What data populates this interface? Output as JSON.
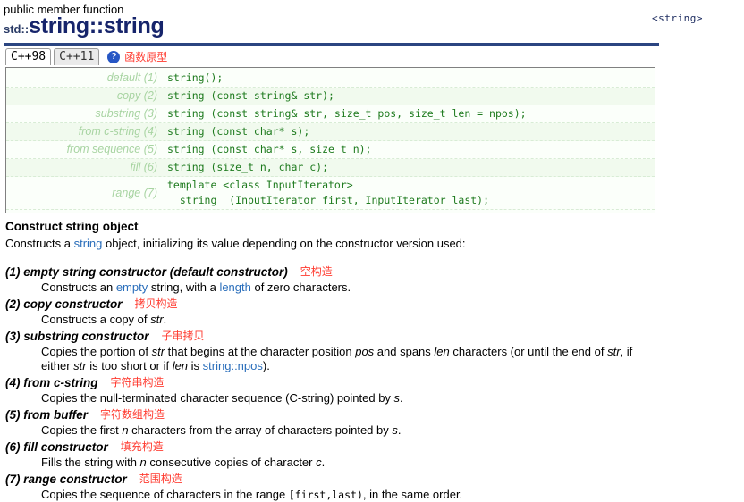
{
  "header": {
    "kind": "public member function",
    "namespace": "std::",
    "name": "string::string",
    "header_file": "<string>"
  },
  "tabs": {
    "items": [
      {
        "label": "C++98",
        "active": true
      },
      {
        "label": "C++11",
        "active": false
      }
    ],
    "help_icon": "question-mark-icon",
    "help_glyph": "?",
    "annotation": "函数原型"
  },
  "prototypes": [
    {
      "label": "default (1)",
      "code": "string();"
    },
    {
      "label": "copy (2)",
      "code": "string (const string& str);"
    },
    {
      "label": "substring (3)",
      "code": "string (const string& str, size_t pos, size_t len = npos);"
    },
    {
      "label": "from c-string (4)",
      "code": "string (const char* s);"
    },
    {
      "label": "from sequence (5)",
      "code": "string (const char* s, size_t n);"
    },
    {
      "label": "fill (6)",
      "code": "string (size_t n, char c);"
    },
    {
      "label": "range (7)",
      "code": "template <class InputIterator>\n  string  (InputIterator first, InputIterator last);"
    }
  ],
  "section": {
    "title": "Construct string object",
    "intro_before": "Constructs a ",
    "intro_link": "string",
    "intro_after": " object, initializing its value depending on the constructor version used:"
  },
  "constructors": [
    {
      "heading": "(1) empty string constructor (default constructor)",
      "annotation": "空构造",
      "desc_parts": [
        {
          "t": "Constructs an "
        },
        {
          "t": "empty",
          "k": "link"
        },
        {
          "t": " string, with a "
        },
        {
          "t": "length",
          "k": "link"
        },
        {
          "t": " of zero characters."
        }
      ]
    },
    {
      "heading": "(2) copy constructor",
      "annotation": "拷贝构造",
      "desc_parts": [
        {
          "t": "Constructs a copy of "
        },
        {
          "t": "str",
          "k": "it"
        },
        {
          "t": "."
        }
      ]
    },
    {
      "heading": "(3) substring constructor",
      "annotation": "子串拷贝",
      "desc_parts": [
        {
          "t": "Copies the portion of "
        },
        {
          "t": "str",
          "k": "it"
        },
        {
          "t": " that begins at the character position "
        },
        {
          "t": "pos",
          "k": "it"
        },
        {
          "t": " and spans "
        },
        {
          "t": "len",
          "k": "it"
        },
        {
          "t": " characters (or until the end of "
        },
        {
          "t": "str",
          "k": "it"
        },
        {
          "t": ", if either "
        },
        {
          "t": "str",
          "k": "it"
        },
        {
          "t": " is too short or if "
        },
        {
          "t": "len",
          "k": "it"
        },
        {
          "t": " is "
        },
        {
          "t": "string::npos",
          "k": "link"
        },
        {
          "t": ")."
        }
      ]
    },
    {
      "heading": "(4) from c-string",
      "annotation": "字符串构造",
      "desc_parts": [
        {
          "t": "Copies the null-terminated character sequence (C-string) pointed by "
        },
        {
          "t": "s",
          "k": "it"
        },
        {
          "t": "."
        }
      ]
    },
    {
      "heading": "(5) from buffer",
      "annotation": "字符数组构造",
      "desc_parts": [
        {
          "t": "Copies the first "
        },
        {
          "t": "n",
          "k": "it"
        },
        {
          "t": " characters from the array of characters pointed by "
        },
        {
          "t": "s",
          "k": "it"
        },
        {
          "t": "."
        }
      ]
    },
    {
      "heading": "(6) fill constructor",
      "annotation": "填充构造",
      "desc_parts": [
        {
          "t": "Fills the string with "
        },
        {
          "t": "n",
          "k": "it"
        },
        {
          "t": " consecutive copies of character "
        },
        {
          "t": "c",
          "k": "it"
        },
        {
          "t": "."
        }
      ]
    },
    {
      "heading": "(7) range constructor",
      "annotation": "范围构造",
      "desc_parts": [
        {
          "t": "Copies the sequence of characters in the range "
        },
        {
          "t": "[first,last)",
          "k": "mono"
        },
        {
          "t": ", in the same order."
        }
      ]
    }
  ],
  "colors": {
    "rule": "#2b4581",
    "title": "#16246b",
    "code": "#1d7a1d",
    "label": "#a8d4a2",
    "link": "#2a6ebb",
    "annotation": "#ff3b30",
    "box_bg": "#fbfffa",
    "box_alt_bg": "#f1faee"
  }
}
